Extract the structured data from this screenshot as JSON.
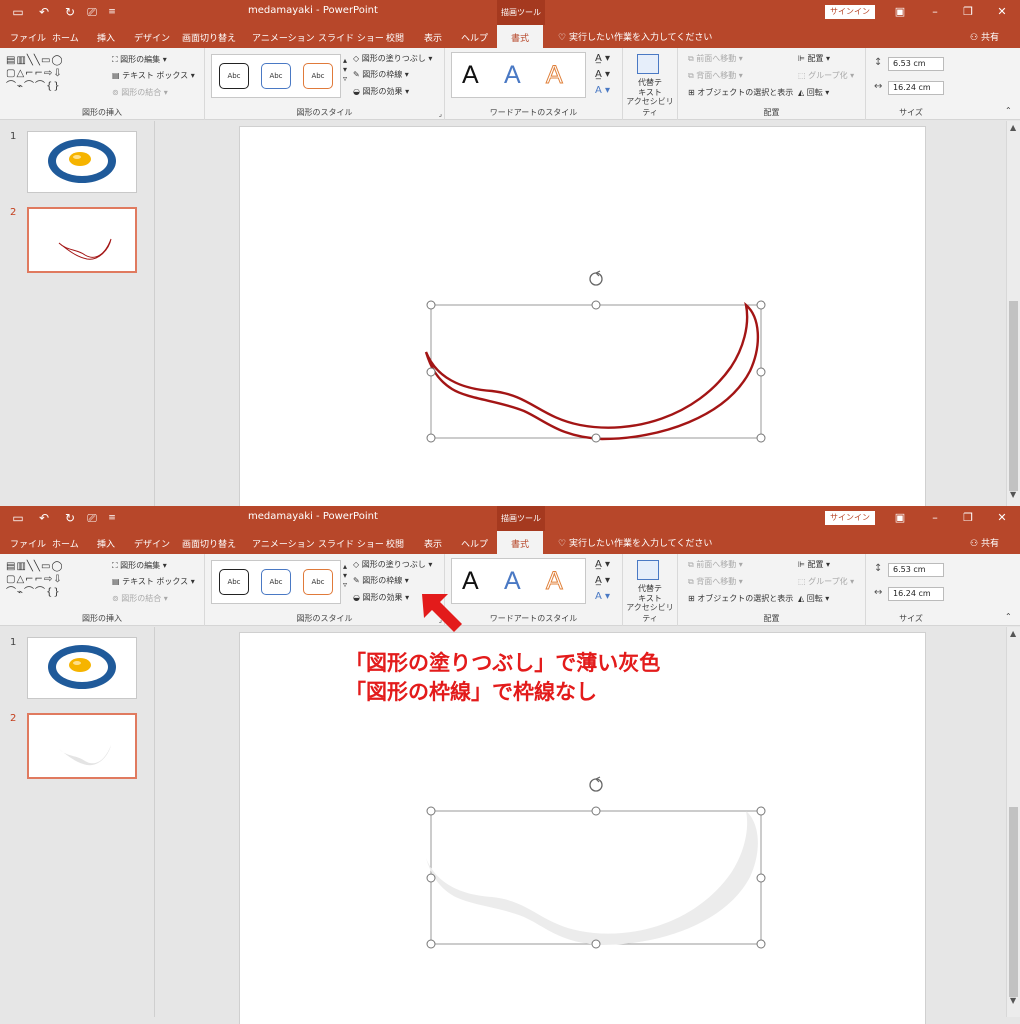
{
  "app": {
    "doc_title": "medamayaki  -  PowerPoint",
    "context_tool": "描画ツール",
    "signin": "サインイン",
    "share": "共有",
    "tell_me": "実行したい作業を入力してください"
  },
  "tabs": [
    "ファイル",
    "ホーム",
    "挿入",
    "デザイン",
    "画面切り替え",
    "アニメーション",
    "スライド ショー",
    "校閲",
    "表示",
    "ヘルプ",
    "書式"
  ],
  "active_tab": "書式",
  "ribbon": {
    "insert_shapes": {
      "edit_shape": "図形の編集",
      "text_box": "テキスト ボックス",
      "merge_shapes": "図形の結合",
      "label": "図形の挿入"
    },
    "shape_styles": {
      "thumb_text": "Abc",
      "fill": "図形の塗りつぶし",
      "outline": "図形の枠線",
      "effects": "図形の効果",
      "label": "図形のスタイル"
    },
    "wordart": {
      "letter": "A",
      "label": "ワードアートのスタイル"
    },
    "accessibility": {
      "alt_text": "代替テ\nキスト",
      "alt_text_l1": "代替テ",
      "alt_text_l2": "キスト",
      "label": "アクセシビリティ"
    },
    "arrange": {
      "bring_forward": "前面へ移動",
      "send_backward": "背面へ移動",
      "selection_pane": "オブジェクトの選択と表示",
      "align": "配置",
      "group": "グループ化",
      "rotate": "回転",
      "label": "配置"
    },
    "size": {
      "height": "6.53 cm",
      "width": "16.24 cm",
      "label": "サイズ"
    }
  },
  "slides": [
    {
      "number": "1",
      "selected": false
    },
    {
      "number": "2",
      "selected": true
    }
  ],
  "annotation": {
    "line1": "「図形の塗りつぶし」で薄い灰色",
    "line2": "「図形の枠線」で枠線なし"
  },
  "colors": {
    "accent": "#b7472a",
    "shape_outline_before": "#a31515",
    "shape_fill_after": "#ececec",
    "annotation": "#e31b1b",
    "egg_ring": "#1f5a9a",
    "yolk": "#f6b400"
  }
}
